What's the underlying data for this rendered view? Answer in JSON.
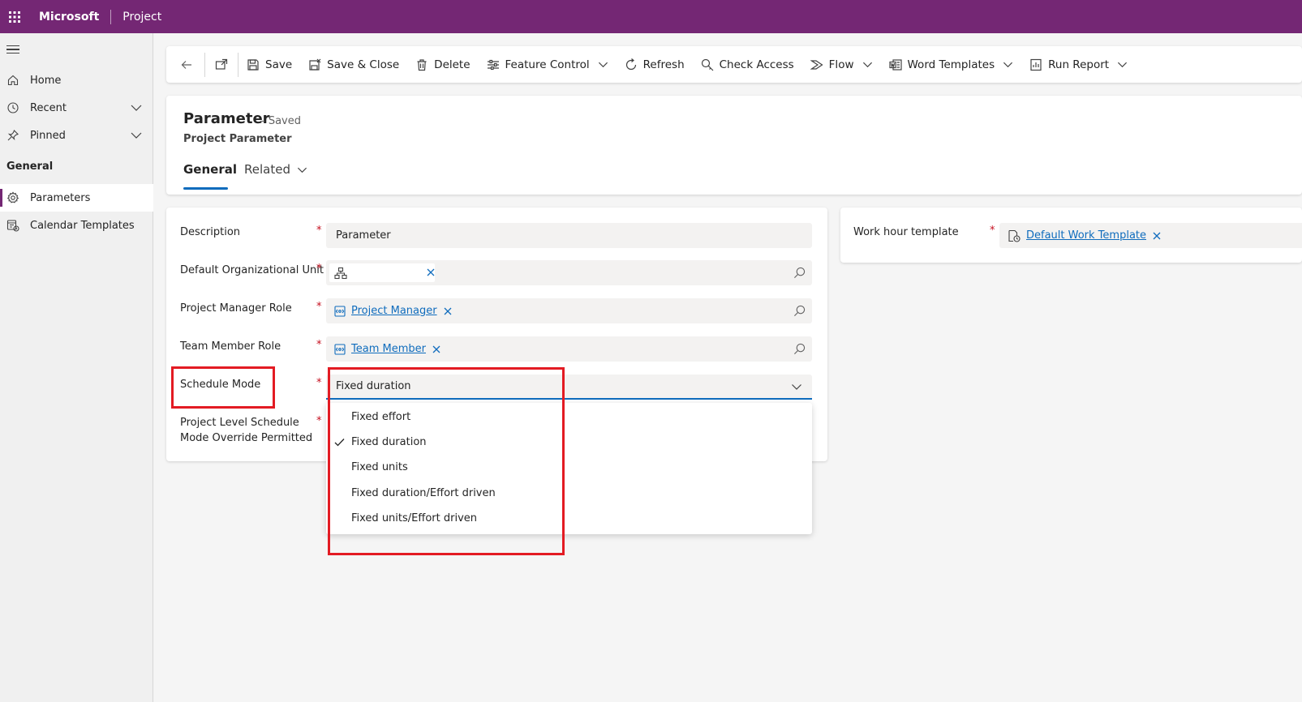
{
  "topbar": {
    "brand": "Microsoft",
    "app": "Project"
  },
  "sidebar": {
    "items": [
      {
        "label": "Home",
        "icon": "home-icon"
      },
      {
        "label": "Recent",
        "icon": "clock-icon"
      },
      {
        "label": "Pinned",
        "icon": "pin-icon"
      }
    ],
    "group_heading": "General",
    "group_items": [
      {
        "label": "Parameters",
        "icon": "gear-icon",
        "active": true
      },
      {
        "label": "Calendar Templates",
        "icon": "calendar-template-icon"
      }
    ]
  },
  "commands": {
    "save": "Save",
    "save_close": "Save & Close",
    "delete": "Delete",
    "feature_control": "Feature Control",
    "refresh": "Refresh",
    "check_access": "Check Access",
    "flow": "Flow",
    "word_templates": "Word Templates",
    "run_report": "Run Report"
  },
  "header": {
    "title": "Parameter",
    "status": "- Saved",
    "entity": "Project Parameter",
    "tabs": {
      "general": "General",
      "related": "Related"
    }
  },
  "form": {
    "description": {
      "label": "Description",
      "value": "Parameter"
    },
    "org_unit": {
      "label": "Default Organizational Unit"
    },
    "pm_role": {
      "label": "Project Manager Role",
      "value": "Project Manager"
    },
    "team_role": {
      "label": "Team Member Role",
      "value": "Team Member"
    },
    "schedule_mode": {
      "label": "Schedule Mode",
      "value": "Fixed duration"
    },
    "override": {
      "label_line1": "Project Level Schedule",
      "label_line2": "Mode Override Permitted"
    },
    "required_marker": "*"
  },
  "dropdown": {
    "options": [
      {
        "label": "Fixed effort",
        "selected": false
      },
      {
        "label": "Fixed duration",
        "selected": true
      },
      {
        "label": "Fixed units",
        "selected": false
      },
      {
        "label": "Fixed duration/Effort driven",
        "selected": false
      },
      {
        "label": "Fixed units/Effort driven",
        "selected": false
      }
    ]
  },
  "side_form": {
    "work_hour": {
      "label": "Work hour template",
      "value": "Default Work Template"
    }
  },
  "colors": {
    "brand": "#742774",
    "accent": "#0f6cbd",
    "annotation": "#e31b23",
    "required": "#c50f1f"
  }
}
